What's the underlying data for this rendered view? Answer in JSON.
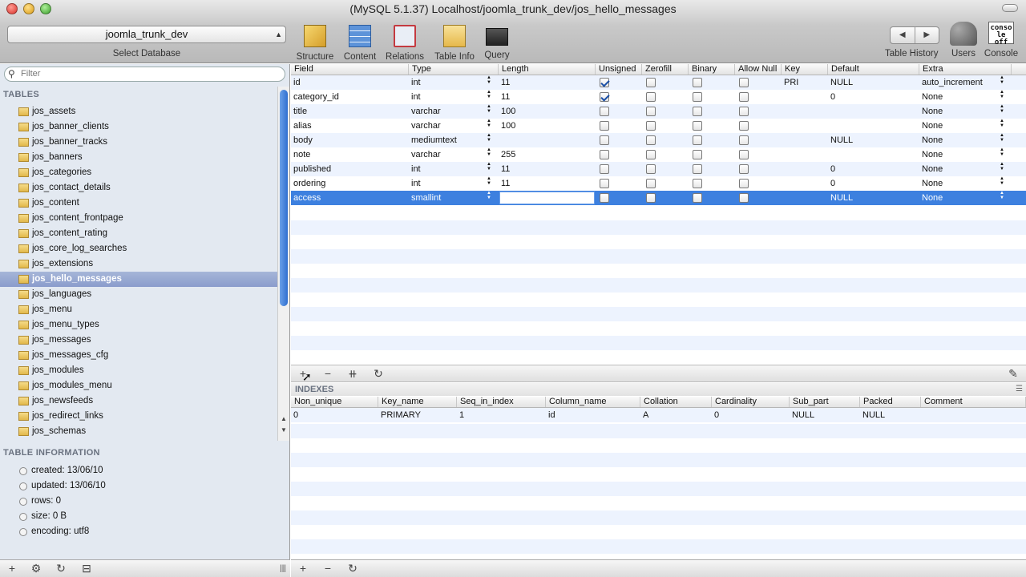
{
  "window": {
    "title": "(MySQL 5.1.37) Localhost/joomla_trunk_dev/jos_hello_messages"
  },
  "database": {
    "selected": "joomla_trunk_dev",
    "label": "Select Database"
  },
  "toolbar": {
    "structure": "Structure",
    "content": "Content",
    "relations": "Relations",
    "table_info": "Table Info",
    "query": "Query",
    "history": "Table History",
    "users": "Users",
    "console": "Console",
    "console_icon_text": "conso le off"
  },
  "sidebar": {
    "filter_placeholder": "Filter",
    "tables_heading": "TABLES",
    "tables": [
      "jos_assets",
      "jos_banner_clients",
      "jos_banner_tracks",
      "jos_banners",
      "jos_categories",
      "jos_contact_details",
      "jos_content",
      "jos_content_frontpage",
      "jos_content_rating",
      "jos_core_log_searches",
      "jos_extensions",
      "jos_hello_messages",
      "jos_languages",
      "jos_menu",
      "jos_menu_types",
      "jos_messages",
      "jos_messages_cfg",
      "jos_modules",
      "jos_modules_menu",
      "jos_newsfeeds",
      "jos_redirect_links",
      "jos_schemas"
    ],
    "selected_table": "jos_hello_messages",
    "info_heading": "TABLE INFORMATION",
    "info": [
      "created: 13/06/10",
      "updated: 13/06/10",
      "rows: 0",
      "size: 0 B",
      "encoding: utf8"
    ]
  },
  "fields": {
    "columns": [
      "Field",
      "Type",
      "Length",
      "Unsigned",
      "Zerofill",
      "Binary",
      "Allow Null",
      "Key",
      "Default",
      "Extra"
    ],
    "rows": [
      {
        "field": "id",
        "type": "int",
        "length": "11",
        "unsigned": true,
        "zerofill": false,
        "binary": false,
        "allow_null": false,
        "key": "PRI",
        "default": "NULL",
        "extra": "auto_increment"
      },
      {
        "field": "category_id",
        "type": "int",
        "length": "11",
        "unsigned": true,
        "zerofill": false,
        "binary": false,
        "allow_null": false,
        "key": "",
        "default": "0",
        "extra": "None"
      },
      {
        "field": "title",
        "type": "varchar",
        "length": "100",
        "unsigned": false,
        "zerofill": false,
        "binary": false,
        "allow_null": false,
        "key": "",
        "default": "",
        "extra": "None"
      },
      {
        "field": "alias",
        "type": "varchar",
        "length": "100",
        "unsigned": false,
        "zerofill": false,
        "binary": false,
        "allow_null": false,
        "key": "",
        "default": "",
        "extra": "None"
      },
      {
        "field": "body",
        "type": "mediumtext",
        "length": "",
        "unsigned": false,
        "zerofill": false,
        "binary": false,
        "allow_null": false,
        "key": "",
        "default": "NULL",
        "extra": "None"
      },
      {
        "field": "note",
        "type": "varchar",
        "length": "255",
        "unsigned": false,
        "zerofill": false,
        "binary": false,
        "allow_null": false,
        "key": "",
        "default": "",
        "extra": "None"
      },
      {
        "field": "published",
        "type": "int",
        "length": "11",
        "unsigned": false,
        "zerofill": false,
        "binary": false,
        "allow_null": false,
        "key": "",
        "default": "0",
        "extra": "None"
      },
      {
        "field": "ordering",
        "type": "int",
        "length": "11",
        "unsigned": false,
        "zerofill": false,
        "binary": false,
        "allow_null": false,
        "key": "",
        "default": "0",
        "extra": "None"
      },
      {
        "field": "access",
        "type": "smallint",
        "length": "",
        "unsigned": false,
        "zerofill": false,
        "binary": false,
        "allow_null": false,
        "key": "",
        "default": "NULL",
        "extra": "None",
        "selected": true
      }
    ]
  },
  "indexes": {
    "heading": "INDEXES",
    "columns": [
      "Non_unique",
      "Key_name",
      "Seq_in_index",
      "Column_name",
      "Collation",
      "Cardinality",
      "Sub_part",
      "Packed",
      "Comment"
    ],
    "rows": [
      {
        "non_unique": "0",
        "key_name": "PRIMARY",
        "seq_in_index": "1",
        "column_name": "id",
        "collation": "A",
        "cardinality": "0",
        "sub_part": "NULL",
        "packed": "NULL",
        "comment": ""
      }
    ]
  }
}
